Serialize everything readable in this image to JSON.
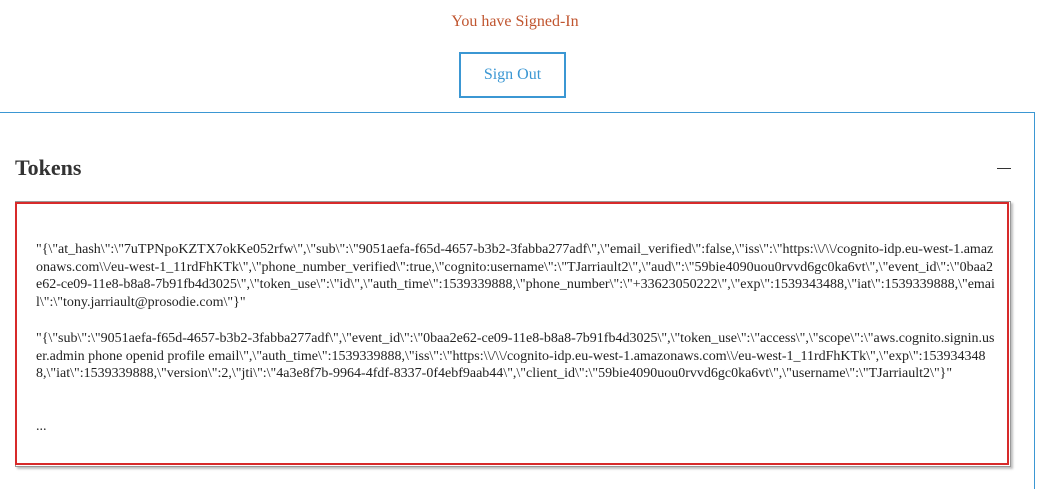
{
  "status": {
    "message": "You have Signed-In"
  },
  "actions": {
    "sign_out_label": "Sign Out"
  },
  "tokens_panel": {
    "title": "Tokens",
    "id_token": "\"{\\\"at_hash\\\":\\\"7uTPNpoKZTX7okKe052rfw\\\",\\\"sub\\\":\\\"9051aefa-f65d-4657-b3b2-3fabba277adf\\\",\\\"email_verified\\\":false,\\\"iss\\\":\\\"https:\\\\/\\\\/cognito-idp.eu-west-1.amazonaws.com\\\\/eu-west-1_11rdFhKTk\\\",\\\"phone_number_verified\\\":true,\\\"cognito:username\\\":\\\"TJarriault2\\\",\\\"aud\\\":\\\"59bie4090uou0rvvd6gc0ka6vt\\\",\\\"event_id\\\":\\\"0baa2e62-ce09-11e8-b8a8-7b91fb4d3025\\\",\\\"token_use\\\":\\\"id\\\",\\\"auth_time\\\":1539339888,\\\"phone_number\\\":\\\"+33623050222\\\",\\\"exp\\\":1539343488,\\\"iat\\\":1539339888,\\\"email\\\":\\\"tony.jarriault@prosodie.com\\\"}\"",
    "access_token": "\"{\\\"sub\\\":\\\"9051aefa-f65d-4657-b3b2-3fabba277adf\\\",\\\"event_id\\\":\\\"0baa2e62-ce09-11e8-b8a8-7b91fb4d3025\\\",\\\"token_use\\\":\\\"access\\\",\\\"scope\\\":\\\"aws.cognito.signin.user.admin phone openid profile email\\\",\\\"auth_time\\\":1539339888,\\\"iss\\\":\\\"https:\\\\/\\\\/cognito-idp.eu-west-1.amazonaws.com\\\\/eu-west-1_11rdFhKTk\\\",\\\"exp\\\":1539343488,\\\"iat\\\":1539339888,\\\"version\\\":2,\\\"jti\\\":\\\"4a3e8f7b-9964-4fdf-8337-0f4ebf9aab44\\\",\\\"client_id\\\":\\\"59bie4090uou0rvvd6gc0ka6vt\\\",\\\"username\\\":\\\"TJarriault2\\\"}\"",
    "ellipsis": "..."
  },
  "colors": {
    "status_text": "#c0552f",
    "accent_blue": "#3b97d3",
    "highlight_red": "#d72a2a"
  }
}
